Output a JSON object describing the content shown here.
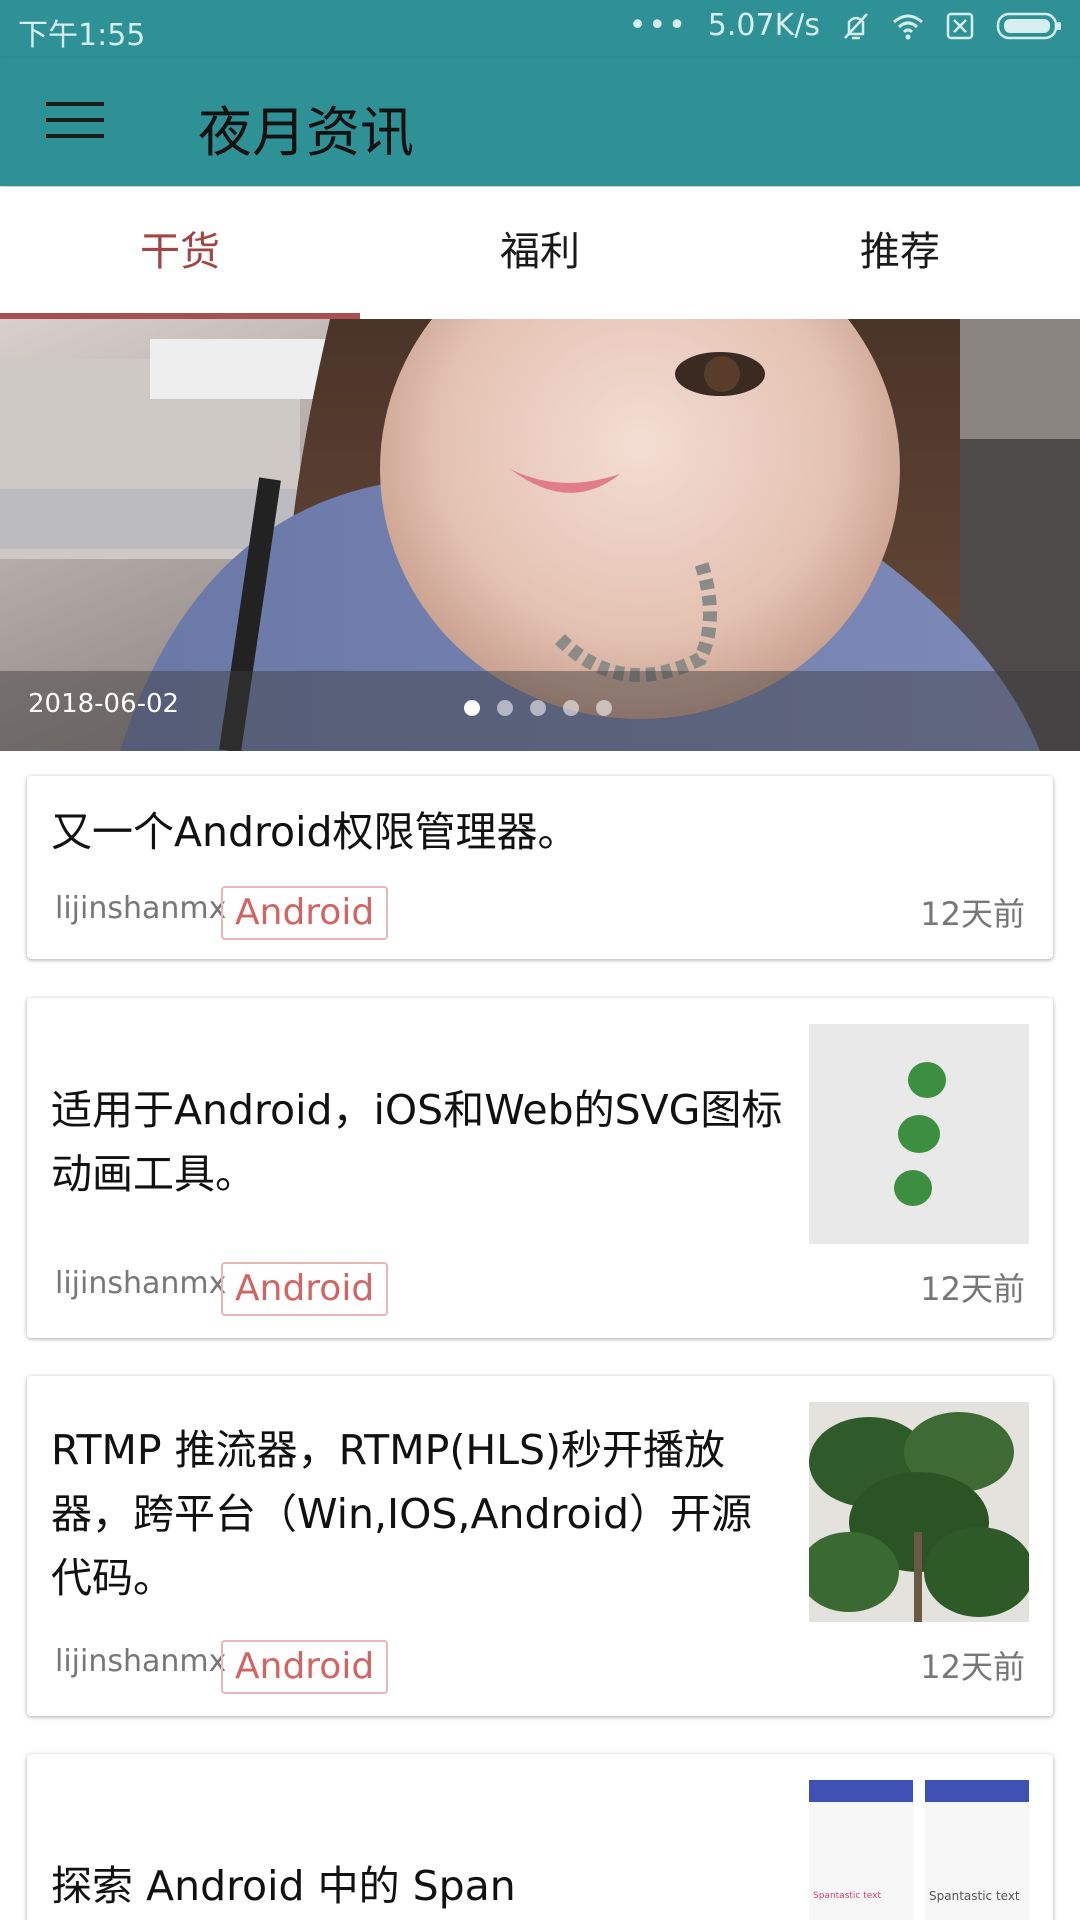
{
  "status_bar": {
    "time": "下午1:55",
    "dots": "•••",
    "network_speed": "5.07K/s"
  },
  "app_bar": {
    "title": "夜月资讯"
  },
  "tabs": [
    {
      "label": "干货",
      "active": true
    },
    {
      "label": "福利",
      "active": false
    },
    {
      "label": "推荐",
      "active": false
    }
  ],
  "banner": {
    "date": "2018-06-02",
    "page_count": 5,
    "current_page": 1
  },
  "articles": [
    {
      "title": "又一个Android权限管理器。",
      "author": "lijinshanmx",
      "tag": "Android",
      "time_ago": "12天前"
    },
    {
      "title_line1": "适用于Android，iOS和Web的SVG图标",
      "title_line2": "动画工具。",
      "author": "lijinshanmx",
      "tag": "Android",
      "time_ago": "12天前"
    },
    {
      "title_line1": "RTMP 推流器，RTMP(HLS)秒开播放",
      "title_line2": "器，跨平台（Win,IOS,Android）开源",
      "title_line3": "代码。",
      "author": "lijinshanmx",
      "tag": "Android",
      "time_ago": "12天前"
    },
    {
      "title": "探索 Android 中的 Span",
      "thumb_text_left": "Spantastic text",
      "thumb_text_right": "Spantastic text"
    }
  ],
  "colors": {
    "primary": "#2e9196",
    "tab_active": "#a04545",
    "tag_text": "#d06562"
  }
}
